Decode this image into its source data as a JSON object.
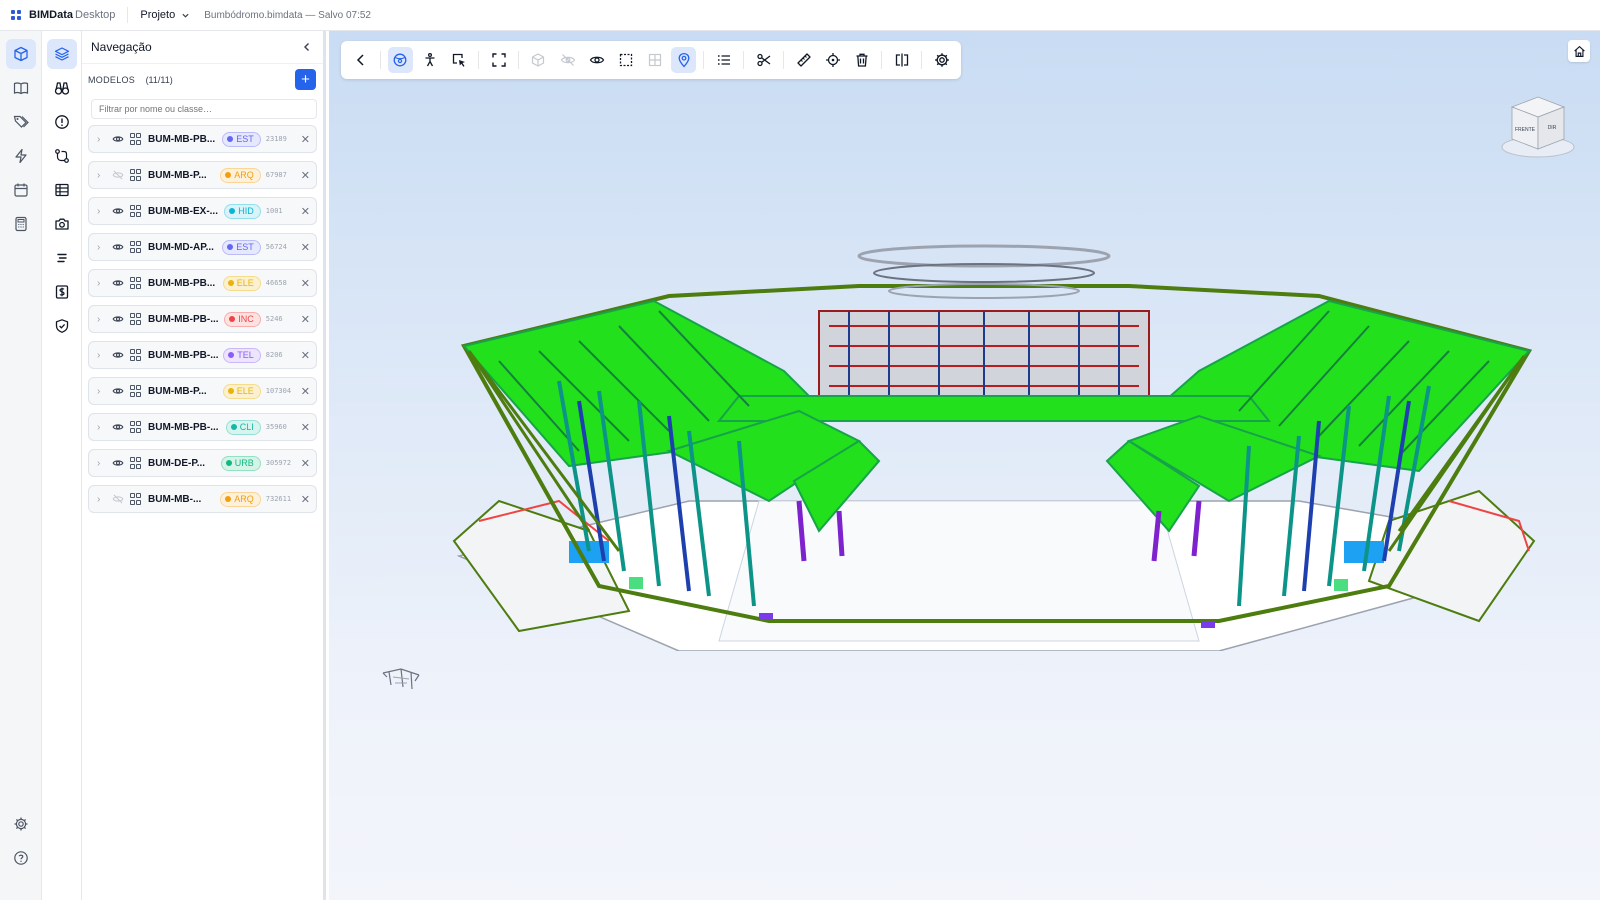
{
  "app": {
    "name": "BIMData",
    "edition": "Desktop"
  },
  "titlebar": {
    "menu_label": "Projeto",
    "file_status": "Bumbódromo.bimdata — Salvo 07:52"
  },
  "panel": {
    "title": "Navegação",
    "models_label": "MODELOS",
    "models_count": "(11/11)",
    "filter_placeholder": "Filtrar por nome ou classe…",
    "models": [
      {
        "name": "BUM-MB-PB...",
        "tag": "EST",
        "count": "23189",
        "visible": true,
        "tag_color": "#6366f1",
        "tag_bg": "#e6e8fd"
      },
      {
        "name": "BUM-MB-P...",
        "tag": "ARQ",
        "count": "67987",
        "visible": false,
        "tag_color": "#f59e0b",
        "tag_bg": "#fdf1dc"
      },
      {
        "name": "BUM-MB-EX-...",
        "tag": "HID",
        "count": "1001",
        "visible": true,
        "tag_color": "#06b6d4",
        "tag_bg": "#d9f3f8"
      },
      {
        "name": "BUM-MD-AP...",
        "tag": "EST",
        "count": "56724",
        "visible": true,
        "tag_color": "#6366f1",
        "tag_bg": "#e6e8fd"
      },
      {
        "name": "BUM-MB-PB...",
        "tag": "ELE",
        "count": "46658",
        "visible": true,
        "tag_color": "#eab308",
        "tag_bg": "#fbf1d0"
      },
      {
        "name": "BUM-MB-PB-...",
        "tag": "INC",
        "count": "5246",
        "visible": true,
        "tag_color": "#ef4444",
        "tag_bg": "#fde2e2"
      },
      {
        "name": "BUM-MB-PB-...",
        "tag": "TEL",
        "count": "8206",
        "visible": true,
        "tag_color": "#8b5cf6",
        "tag_bg": "#ece5fd"
      },
      {
        "name": "BUM-MB-P...",
        "tag": "ELE",
        "count": "107304",
        "visible": true,
        "tag_color": "#eab308",
        "tag_bg": "#fbf1d0"
      },
      {
        "name": "BUM-MB-PB-...",
        "tag": "CLI",
        "count": "35960",
        "visible": true,
        "tag_color": "#14b8a6",
        "tag_bg": "#d7f4ef"
      },
      {
        "name": "BUM-DE-P...",
        "tag": "URB",
        "count": "305972",
        "visible": true,
        "tag_color": "#10b981",
        "tag_bg": "#d5f3e7"
      },
      {
        "name": "BUM-MB-...",
        "tag": "ARQ",
        "count": "732611",
        "visible": false,
        "tag_color": "#f59e0b",
        "tag_bg": "#fdf1dc"
      }
    ]
  },
  "viewer": {
    "navcube": {
      "front": "FRENTE",
      "right": "DIR"
    }
  },
  "colors": {
    "accent": "#2563eb",
    "accent_soft": "#dde7fb",
    "structure_green": "#22e01b"
  }
}
